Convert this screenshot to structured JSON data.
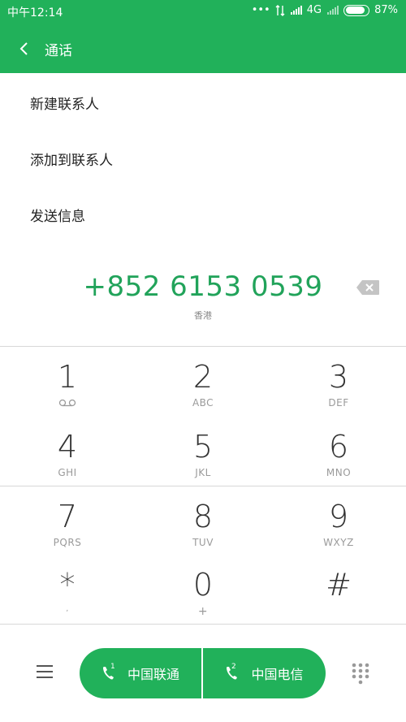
{
  "status_bar": {
    "time": "中午12:14",
    "network": "4G",
    "battery": "87%",
    "battery_level": 0.87
  },
  "header": {
    "title": "通话"
  },
  "menu": [
    {
      "label": "新建联系人"
    },
    {
      "label": "添加到联系人"
    },
    {
      "label": "发送信息"
    }
  ],
  "dialer": {
    "number": "+852 6153 0539",
    "region": "香港",
    "keys": [
      {
        "digit": "1",
        "letters": ""
      },
      {
        "digit": "2",
        "letters": "ABC"
      },
      {
        "digit": "3",
        "letters": "DEF"
      },
      {
        "digit": "4",
        "letters": "GHI"
      },
      {
        "digit": "5",
        "letters": "JKL"
      },
      {
        "digit": "6",
        "letters": "MNO"
      },
      {
        "digit": "7",
        "letters": "PQRS"
      },
      {
        "digit": "8",
        "letters": "TUV"
      },
      {
        "digit": "9",
        "letters": "WXYZ"
      },
      {
        "digit": "*",
        "letters": ","
      },
      {
        "digit": "0",
        "letters": "+"
      },
      {
        "digit": "#",
        "letters": ""
      }
    ]
  },
  "call_buttons": {
    "sim1_label": "中国联通",
    "sim1_index": "1",
    "sim2_label": "中国电信",
    "sim2_index": "2"
  },
  "colors": {
    "accent": "#21b15a",
    "number": "#21a35a"
  }
}
